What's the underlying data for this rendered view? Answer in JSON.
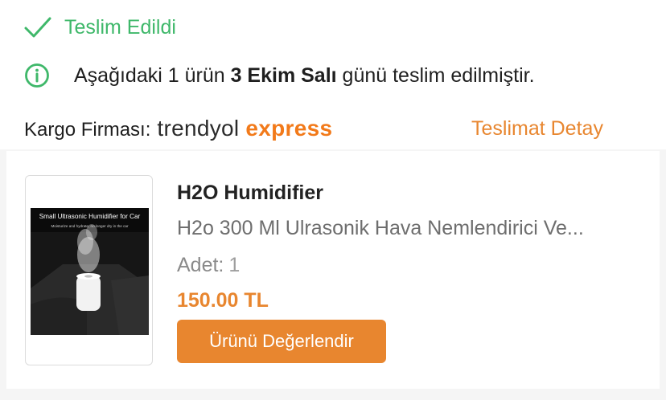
{
  "status": {
    "label": "Teslim Edildi",
    "icon": "check-icon",
    "color": "#3fb86a"
  },
  "info": {
    "icon": "info-circle-icon",
    "prefix": "Aşağıdaki 1 ürün ",
    "date": "3 Ekim Salı",
    "suffix": " günü teslim edilmiştir."
  },
  "cargo": {
    "label": "Kargo Firması:",
    "brand_primary": "trendyol",
    "brand_secondary": "express",
    "detail_link": "Teslimat Detay"
  },
  "product": {
    "image_title": "Small Ultrasonic Humidifier for Car",
    "image_subtitle": "Moisturize and hydrate, no longer dry in the car",
    "title": "H2O Humidifier",
    "description": "H2o 300 Ml Ulrasonik Hava Nemlendirici Ve...",
    "quantity_label": "Adet:",
    "quantity": "1",
    "price": "150.00 TL",
    "rate_button": "Ürünü Değerlendir"
  },
  "colors": {
    "accent": "#e8862f",
    "brand_orange": "#f27a1a",
    "success": "#3fb86a"
  }
}
